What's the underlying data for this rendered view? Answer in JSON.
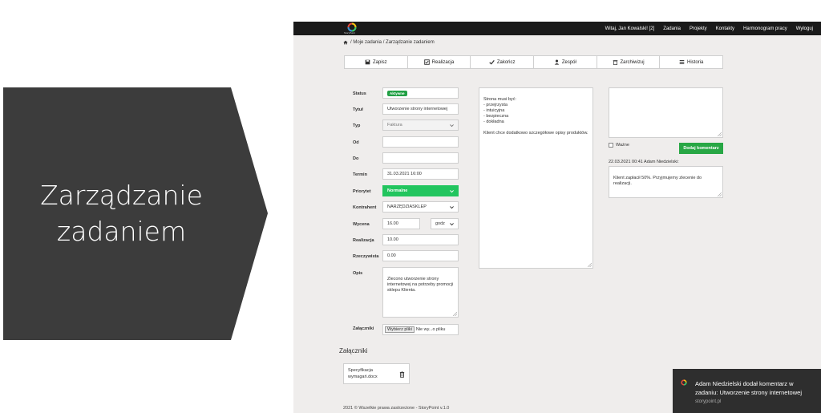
{
  "slide_label": {
    "line1": "Zarządzanie",
    "line2": "zadaniem"
  },
  "app": {
    "logo_text": "StoryPoint",
    "nav": {
      "user": "Witaj, Jan Kowalski! [2]",
      "items": [
        "Zadania",
        "Projekty",
        "Kontakty",
        "Harmonogram pracy",
        "Wyloguj"
      ]
    },
    "breadcrumb": "/ Moje zadania / Zarządzanie zadaniem",
    "toolbar": [
      "Zapisz",
      "Realizacja",
      "Zakończ",
      "Zespół",
      "Zarchiwizuj",
      "Historia"
    ],
    "form": {
      "status_label": "Status",
      "status_value": "Aktywne",
      "title_label": "Tytuł",
      "title_value": "Utworzenie strony internetowej",
      "type_label": "Typ",
      "type_value": "Faktura",
      "from_label": "Od",
      "from_value": "",
      "to_label": "Do",
      "to_value": "",
      "deadline_label": "Termin",
      "deadline_value": "31.03.2021 16:00",
      "priority_label": "Priorytet",
      "priority_value": "Normalne",
      "contractor_label": "Kontrahent",
      "contractor_value": "NARZĘDZIASKLEP",
      "estimate_label": "Wycena",
      "estimate_value": "16.00",
      "estimate_unit": "godz",
      "realization_label": "Realizacja",
      "realization_value": "10.00",
      "actual_label": "Rzeczywista",
      "actual_value": "0.00",
      "description_label": "Opis",
      "description_value": "Zlecono utworzenie strony internetowej na potrzeby promocji sklepu Klienta.",
      "attachments_label": "Załączniki",
      "file_button": "Wybierz pliki",
      "file_status": "Nie wy...o pliku"
    },
    "notes_value": "Strona musi być:\n- przejrzysta\n- intuicyjna\n- bezpieczna\n- dokładna\n\nKlient chce dodatkowo szczegółowe opisy produktów.",
    "comments": {
      "important_label": "Ważne",
      "add_button": "Dodaj komentarz",
      "meta": "22.03.2021 00:41 Adam Niedzielski:",
      "text": "Klient zapłacił 50%. Przyjmujemy zlecenie do realizacji."
    },
    "attachments": {
      "title": "Załączniki",
      "file_name": "Specyfikacja wymagań.docx"
    },
    "footer": "2021 © Wszelkie prawa zastrzeżone - StoryPoint v.1.0"
  },
  "toast": {
    "title": "Adam Niedzielski dodał komentarz w zadaniu: Utworzenie strony internetowej",
    "source": "storypoint.pl"
  },
  "colors": {
    "arrow": "#3c3c3c",
    "topbar": "#1a1a1a",
    "priority": "#22c55e",
    "button_green": "#28a745",
    "toast": "#2e2e2e"
  }
}
